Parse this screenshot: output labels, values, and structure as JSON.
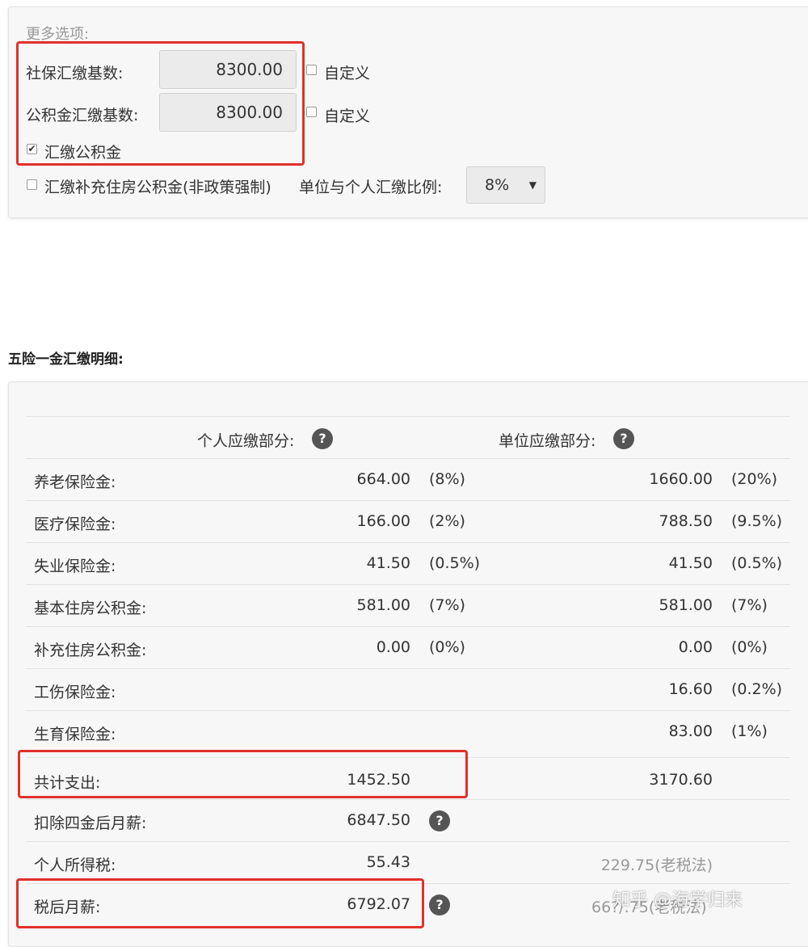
{
  "options": {
    "title": "更多选项:",
    "social_base_label": "社保汇缴基数:",
    "social_base_value": "8300.00",
    "fund_base_label": "公积金汇缴基数:",
    "fund_base_value": "8300.00",
    "custom_label": "自定义",
    "pay_fund_label": "汇缴公积金",
    "pay_supp_fund_label": "汇缴补充住房公积金(非政策强制)",
    "ratio_label": "单位与个人汇缴比例:",
    "ratio_value": "8%",
    "check_mark": "✔",
    "dropdown_arrow": "▼"
  },
  "details": {
    "heading": "五险一金汇缴明细:",
    "personal_header": "个人应缴部分:",
    "company_header": "单位应缴部分:",
    "help_glyph": "?",
    "rows": [
      {
        "label": "养老保险金:",
        "p_val": "664.00",
        "p_pct": "(8%)",
        "c_val": "1660.00",
        "c_pct": "(20%)"
      },
      {
        "label": "医疗保险金:",
        "p_val": "166.00",
        "p_pct": "(2%)",
        "c_val": "788.50",
        "c_pct": "(9.5%)"
      },
      {
        "label": "失业保险金:",
        "p_val": "41.50",
        "p_pct": "(0.5%)",
        "c_val": "41.50",
        "c_pct": "(0.5%)"
      },
      {
        "label": "基本住房公积金:",
        "p_val": "581.00",
        "p_pct": "(7%)",
        "c_val": "581.00",
        "c_pct": "(7%)"
      },
      {
        "label": "补充住房公积金:",
        "p_val": "0.00",
        "p_pct": "(0%)",
        "c_val": "0.00",
        "c_pct": "(0%)"
      },
      {
        "label": "工伤保险金:",
        "p_val": "",
        "p_pct": "",
        "c_val": "16.60",
        "c_pct": "(0.2%)"
      },
      {
        "label": "生育保险金:",
        "p_val": "",
        "p_pct": "",
        "c_val": "83.00",
        "c_pct": "(1%)"
      }
    ],
    "total_label": "共计支出:",
    "total_personal": "1452.50",
    "total_company": "3170.60",
    "after_label": "扣除四金后月薪:",
    "after_value": "6847.50",
    "tax_label": "个人所得税:",
    "tax_value": "55.43",
    "tax_old": "229.75(老税法)",
    "net_label": "税后月薪:",
    "net_value": "6792.07",
    "net_old": "66?/.75(老税法)"
  },
  "watermark": "知乎 @海学归来",
  "colors": {
    "highlight": "#e0312a",
    "help_icon": "#555555"
  }
}
